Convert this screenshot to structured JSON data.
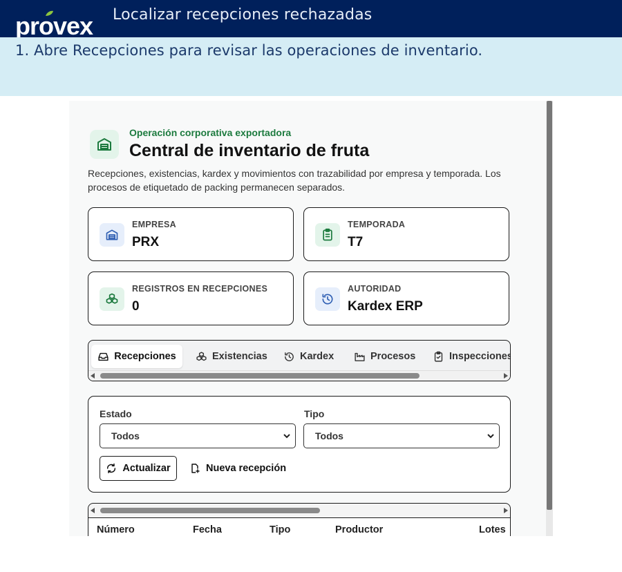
{
  "header": {
    "title": "Localizar recepciones rechazadas",
    "logo_text": "provex"
  },
  "step": {
    "text": "1. Abre Recepciones para revisar las operaciones de inventario."
  },
  "app": {
    "eyebrow": "Operación corporativa exportadora",
    "title": "Central de inventario de fruta",
    "description": "Recepciones, existencias, kardex y movimientos con trazabilidad por empresa y temporada. Los procesos de etiquetado de packing permanecen separados.",
    "cards": [
      {
        "label": "EMPRESA",
        "value": "PRX",
        "icon": "building-icon"
      },
      {
        "label": "TEMPORADA",
        "value": "T7",
        "icon": "clipboard-icon"
      },
      {
        "label": "REGISTROS EN RECEPCIONES",
        "value": "0",
        "icon": "boxes-icon"
      },
      {
        "label": "AUTORIDAD",
        "value": "Kardex ERP",
        "icon": "history-icon"
      }
    ],
    "tabs": [
      {
        "label": "Recepciones",
        "icon": "inbox-icon",
        "active": true
      },
      {
        "label": "Existencias",
        "icon": "boxes-icon",
        "active": false
      },
      {
        "label": "Kardex",
        "icon": "history-icon",
        "active": false
      },
      {
        "label": "Procesos",
        "icon": "factory-icon",
        "active": false
      },
      {
        "label": "Inspecciones",
        "icon": "clipboard-check-icon",
        "active": false
      }
    ],
    "filters": {
      "estado_label": "Estado",
      "estado_value": "Todos",
      "tipo_label": "Tipo",
      "tipo_value": "Todos",
      "refresh_label": "Actualizar",
      "new_label": "Nueva recepción"
    },
    "table": {
      "columns": [
        "Número",
        "Fecha",
        "Tipo",
        "Productor",
        "Lotes"
      ]
    }
  },
  "colors": {
    "brand_navy": "#00205b",
    "brand_green": "#8dc63f",
    "step_bg": "#d5edf5",
    "accent_green": "#1c7a3e"
  }
}
